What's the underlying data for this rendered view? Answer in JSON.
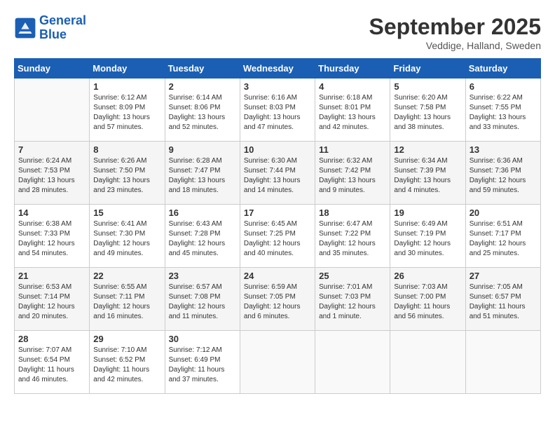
{
  "header": {
    "logo": {
      "line1": "General",
      "line2": "Blue"
    },
    "month": "September 2025",
    "location": "Veddige, Halland, Sweden"
  },
  "weekdays": [
    "Sunday",
    "Monday",
    "Tuesday",
    "Wednesday",
    "Thursday",
    "Friday",
    "Saturday"
  ],
  "weeks": [
    [
      {
        "day": "",
        "info": ""
      },
      {
        "day": "1",
        "info": "Sunrise: 6:12 AM\nSunset: 8:09 PM\nDaylight: 13 hours\nand 57 minutes."
      },
      {
        "day": "2",
        "info": "Sunrise: 6:14 AM\nSunset: 8:06 PM\nDaylight: 13 hours\nand 52 minutes."
      },
      {
        "day": "3",
        "info": "Sunrise: 6:16 AM\nSunset: 8:03 PM\nDaylight: 13 hours\nand 47 minutes."
      },
      {
        "day": "4",
        "info": "Sunrise: 6:18 AM\nSunset: 8:01 PM\nDaylight: 13 hours\nand 42 minutes."
      },
      {
        "day": "5",
        "info": "Sunrise: 6:20 AM\nSunset: 7:58 PM\nDaylight: 13 hours\nand 38 minutes."
      },
      {
        "day": "6",
        "info": "Sunrise: 6:22 AM\nSunset: 7:55 PM\nDaylight: 13 hours\nand 33 minutes."
      }
    ],
    [
      {
        "day": "7",
        "info": "Sunrise: 6:24 AM\nSunset: 7:53 PM\nDaylight: 13 hours\nand 28 minutes."
      },
      {
        "day": "8",
        "info": "Sunrise: 6:26 AM\nSunset: 7:50 PM\nDaylight: 13 hours\nand 23 minutes."
      },
      {
        "day": "9",
        "info": "Sunrise: 6:28 AM\nSunset: 7:47 PM\nDaylight: 13 hours\nand 18 minutes."
      },
      {
        "day": "10",
        "info": "Sunrise: 6:30 AM\nSunset: 7:44 PM\nDaylight: 13 hours\nand 14 minutes."
      },
      {
        "day": "11",
        "info": "Sunrise: 6:32 AM\nSunset: 7:42 PM\nDaylight: 13 hours\nand 9 minutes."
      },
      {
        "day": "12",
        "info": "Sunrise: 6:34 AM\nSunset: 7:39 PM\nDaylight: 13 hours\nand 4 minutes."
      },
      {
        "day": "13",
        "info": "Sunrise: 6:36 AM\nSunset: 7:36 PM\nDaylight: 12 hours\nand 59 minutes."
      }
    ],
    [
      {
        "day": "14",
        "info": "Sunrise: 6:38 AM\nSunset: 7:33 PM\nDaylight: 12 hours\nand 54 minutes."
      },
      {
        "day": "15",
        "info": "Sunrise: 6:41 AM\nSunset: 7:30 PM\nDaylight: 12 hours\nand 49 minutes."
      },
      {
        "day": "16",
        "info": "Sunrise: 6:43 AM\nSunset: 7:28 PM\nDaylight: 12 hours\nand 45 minutes."
      },
      {
        "day": "17",
        "info": "Sunrise: 6:45 AM\nSunset: 7:25 PM\nDaylight: 12 hours\nand 40 minutes."
      },
      {
        "day": "18",
        "info": "Sunrise: 6:47 AM\nSunset: 7:22 PM\nDaylight: 12 hours\nand 35 minutes."
      },
      {
        "day": "19",
        "info": "Sunrise: 6:49 AM\nSunset: 7:19 PM\nDaylight: 12 hours\nand 30 minutes."
      },
      {
        "day": "20",
        "info": "Sunrise: 6:51 AM\nSunset: 7:17 PM\nDaylight: 12 hours\nand 25 minutes."
      }
    ],
    [
      {
        "day": "21",
        "info": "Sunrise: 6:53 AM\nSunset: 7:14 PM\nDaylight: 12 hours\nand 20 minutes."
      },
      {
        "day": "22",
        "info": "Sunrise: 6:55 AM\nSunset: 7:11 PM\nDaylight: 12 hours\nand 16 minutes."
      },
      {
        "day": "23",
        "info": "Sunrise: 6:57 AM\nSunset: 7:08 PM\nDaylight: 12 hours\nand 11 minutes."
      },
      {
        "day": "24",
        "info": "Sunrise: 6:59 AM\nSunset: 7:05 PM\nDaylight: 12 hours\nand 6 minutes."
      },
      {
        "day": "25",
        "info": "Sunrise: 7:01 AM\nSunset: 7:03 PM\nDaylight: 12 hours\nand 1 minute."
      },
      {
        "day": "26",
        "info": "Sunrise: 7:03 AM\nSunset: 7:00 PM\nDaylight: 11 hours\nand 56 minutes."
      },
      {
        "day": "27",
        "info": "Sunrise: 7:05 AM\nSunset: 6:57 PM\nDaylight: 11 hours\nand 51 minutes."
      }
    ],
    [
      {
        "day": "28",
        "info": "Sunrise: 7:07 AM\nSunset: 6:54 PM\nDaylight: 11 hours\nand 46 minutes."
      },
      {
        "day": "29",
        "info": "Sunrise: 7:10 AM\nSunset: 6:52 PM\nDaylight: 11 hours\nand 42 minutes."
      },
      {
        "day": "30",
        "info": "Sunrise: 7:12 AM\nSunset: 6:49 PM\nDaylight: 11 hours\nand 37 minutes."
      },
      {
        "day": "",
        "info": ""
      },
      {
        "day": "",
        "info": ""
      },
      {
        "day": "",
        "info": ""
      },
      {
        "day": "",
        "info": ""
      }
    ]
  ]
}
